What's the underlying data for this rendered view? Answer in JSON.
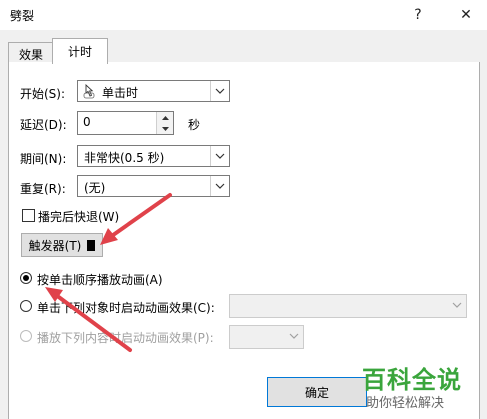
{
  "window": {
    "title": "劈裂",
    "help_glyph": "?",
    "close_glyph": "✕"
  },
  "tabs": [
    {
      "label": "效果"
    },
    {
      "label": "计时"
    }
  ],
  "timing": {
    "start": {
      "label": "开始(S):",
      "value": "单击时"
    },
    "delay": {
      "label": "延迟(D):",
      "value": "0",
      "unit": "秒"
    },
    "duration": {
      "label": "期间(N):",
      "value": "非常快(0.5 秒)"
    },
    "repeat": {
      "label": "重复(R):",
      "value": "(无)"
    },
    "rewind": {
      "label": "播完后快退(W)"
    },
    "triggers": {
      "label": "触发器(T)"
    },
    "radio_sequence": {
      "label": "按单击顺序播放动画(A)"
    },
    "radio_object": {
      "label": "单击下列对象时启动动画效果(C):"
    },
    "radio_content": {
      "label": "播放下列内容时启动动画效果(P):"
    }
  },
  "footer": {
    "ok_label": "确定"
  },
  "watermark": {
    "title": "百科全说",
    "subtitle": "助你轻松解决"
  },
  "colors": {
    "annotation_arrow": "#e0424a",
    "titlebar": "#ffffff",
    "dialog_bg": "#f0f0f0"
  }
}
